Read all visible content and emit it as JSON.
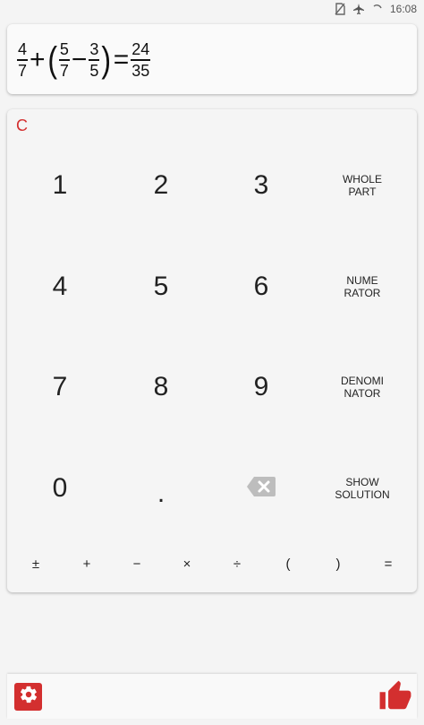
{
  "status_bar": {
    "time": "16:08",
    "icons": [
      "no-sim-icon",
      "airplane-mode-icon",
      "loading-icon"
    ]
  },
  "expression": {
    "frac1": {
      "num": "4",
      "den": "7"
    },
    "plus": "+",
    "open_paren": "(",
    "frac2": {
      "num": "5",
      "den": "7"
    },
    "minus": "−",
    "frac3": {
      "num": "3",
      "den": "5"
    },
    "close_paren": ")",
    "equals": "=",
    "result": {
      "num": "24",
      "den": "35"
    }
  },
  "keypad": {
    "clear_label": "C",
    "digits": {
      "k1": "1",
      "k2": "2",
      "k3": "3",
      "k4": "4",
      "k5": "5",
      "k6": "6",
      "k7": "7",
      "k8": "8",
      "k9": "9",
      "k0": "0",
      "dot": "."
    },
    "functions": {
      "whole_part": "WHOLE\nPART",
      "numerator": "NUME\nRATOR",
      "denominator": "DENOMI\nNATOR",
      "show_solution": "SHOW\nSOLUTION"
    },
    "operators": {
      "plus_minus": "±",
      "plus": "+",
      "minus": "−",
      "times": "×",
      "divide": "÷",
      "open_paren": "(",
      "close_paren": ")",
      "equals": "="
    }
  },
  "colors": {
    "accent": "#d32f2f",
    "backspace_icon": "#bdbdbd"
  },
  "bottom_bar": {
    "settings_icon": "gear-icon",
    "like_icon": "thumbs-up-icon"
  }
}
